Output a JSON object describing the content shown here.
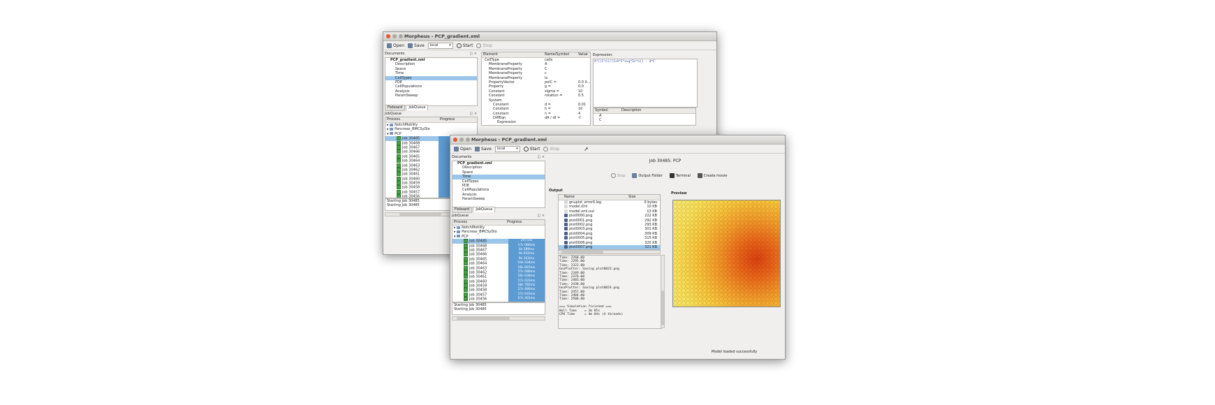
{
  "back_window": {
    "title": "Morpheus - PCP_gradient.xml",
    "toolbar": {
      "open": "Open",
      "save": "Save",
      "mode": "local",
      "start": "Start",
      "stop": "Stop"
    },
    "documents_header": "Documents",
    "doc_tree": [
      "PCP_gradient.xml",
      "Description",
      "Space",
      "Time",
      "CellTypes",
      "PDE",
      "CellPopulations",
      "Analysis",
      "ParamSweep"
    ],
    "tabs": [
      "Fixboard",
      "JobQueue"
    ],
    "jobqueue_header": "JobQueue",
    "columns": {
      "process": "Process",
      "progress": "Progress"
    },
    "groups": [
      "NotchMotility",
      "Pancreas_BMCSyDio",
      "PCP"
    ],
    "jobs": [
      "Job 30485",
      "Job 30468",
      "Job 30467",
      "Job 30466",
      "Job 30465",
      "Job 30464",
      "Job 30463",
      "Job 30462",
      "Job 30461",
      "Job 30460",
      "Job 30459",
      "Job 30458",
      "Job 30457",
      "Job 30456"
    ],
    "log": [
      "Starting Job 30485",
      "Starting Job 30485"
    ],
    "editor_columns": {
      "element": "Element",
      "name": "Name/Symbol",
      "value": "Value"
    },
    "editor_rows": [
      {
        "el": "CellType",
        "name": "cells",
        "val": ""
      },
      {
        "el": "MembraneProperty",
        "name": "A",
        "val": ""
      },
      {
        "el": "MembraneProperty",
        "name": "C",
        "val": ""
      },
      {
        "el": "MembraneProperty",
        "name": "c",
        "val": ""
      },
      {
        "el": "MembraneProperty",
        "name": "Ix",
        "val": ""
      },
      {
        "el": "PropertyVector",
        "name": "polC =",
        "val": "0.0 0..."
      },
      {
        "el": "Property",
        "name": "g =",
        "val": "0.0"
      },
      {
        "el": "Constant",
        "name": "sigma =",
        "val": "10"
      },
      {
        "el": "Constant",
        "name": "rotation =",
        "val": "0.5"
      },
      {
        "el": "System",
        "name": "",
        "val": ""
      },
      {
        "el": "Constant",
        "name": "d =",
        "val": "0.01"
      },
      {
        "el": "Constant",
        "name": "h =",
        "val": "10"
      },
      {
        "el": "Constant",
        "name": "n =",
        "val": "4"
      },
      {
        "el": "DiffEqn",
        "name": "dA / dt =",
        "val": "-f"
      },
      {
        "el": "Expression",
        "name": "",
        "val": ""
      },
      {
        "el": "DiffEqn",
        "name": "dC / dt =",
        "val": "f"
      }
    ],
    "expression_label": "Expression:",
    "expression": "A*((C^n)/(1+h*C^n+g*Ix^n)) - d*C",
    "symbol_columns": {
      "symbol": "Symbol",
      "description": "Description"
    },
    "symbols": [
      "A",
      "C"
    ]
  },
  "front_window": {
    "title": "Morpheus - PCP_gradient.xml",
    "toolbar": {
      "open": "Open",
      "save": "Save",
      "mode": "local",
      "start": "Start",
      "stop": "Stop"
    },
    "documents_header": "Documents",
    "doc_tree": [
      "PCP_gradient.xml",
      "Description",
      "Space",
      "Time",
      "CellTypes",
      "PDE",
      "CellPopulations",
      "Analysis",
      "ParamSweep"
    ],
    "tabs": [
      "Fixboard",
      "JobQueue"
    ],
    "jobqueue_header": "JobQueue",
    "columns": {
      "process": "Process",
      "progress": "Progress"
    },
    "groups": [
      "NotchMotility",
      "Pancreas_BMCSyDio",
      "PCP"
    ],
    "jobs": [
      {
        "name": "Job 30485",
        "progress": "2m 55s"
      },
      {
        "name": "Job 30468",
        "progress": "17s 080ms"
      },
      {
        "name": "Job 30467",
        "progress": "8s 589ms"
      },
      {
        "name": "Job 30466",
        "progress": "8s 032ms"
      },
      {
        "name": "Job 30465",
        "progress": "8s 343ms"
      },
      {
        "name": "Job 30464",
        "progress": "54s 634ms"
      },
      {
        "name": "Job 30463",
        "progress": "56s 822ms"
      },
      {
        "name": "Job 30462",
        "progress": "57s 086ms"
      },
      {
        "name": "Job 30461",
        "progress": "56s 038ms"
      },
      {
        "name": "Job 30460",
        "progress": "57s 020ms"
      },
      {
        "name": "Job 30459",
        "progress": "58s 782ms"
      },
      {
        "name": "Job 30458",
        "progress": "57s 486ms"
      },
      {
        "name": "Job 30457",
        "progress": "57s 033ms"
      },
      {
        "name": "Job 30456",
        "progress": "57s 301ms"
      }
    ],
    "log": [
      "Starting Job 30485",
      "Starting Job 30485"
    ],
    "job_title": "Job 30485: PCP",
    "job_buttons": {
      "stop": "Stop",
      "output": "Output Folder",
      "terminal": "Terminal",
      "movie": "Create movie"
    },
    "output_label": "Output",
    "file_columns": {
      "name": "Name",
      "size": "Size"
    },
    "files": [
      {
        "name": "gnuplot_error0.log",
        "size": "0 bytes"
      },
      {
        "name": "model.xml",
        "size": "10 KB"
      },
      {
        "name": "model.xml.out",
        "size": "13 KB"
      },
      {
        "name": "plot0000.png",
        "size": "222 KB"
      },
      {
        "name": "plot0001.png",
        "size": "292 KB"
      },
      {
        "name": "plot0002.png",
        "size": "293 KB"
      },
      {
        "name": "plot0003.png",
        "size": "301 KB"
      },
      {
        "name": "plot0004.png",
        "size": "309 KB"
      },
      {
        "name": "plot0005.png",
        "size": "315 KB"
      },
      {
        "name": "plot0006.png",
        "size": "320 KB"
      },
      {
        "name": "plot0007.png",
        "size": "321 KB"
      },
      {
        "name": "plot0008.png",
        "size": "324 KB"
      }
    ],
    "selected_file_index": 10,
    "preview_label": "Preview",
    "terminal": [
      "Time: 2268.00",
      "Time: 2295.00",
      "Time: 2322.00",
      "GnuPlotter: Saving plot0023.png",
      "Time: 2349.00",
      "Time: 2376.00",
      "Time: 2403.00",
      "Time: 2430.00",
      "GnuPlotter: Saving plot0024.png",
      "Time: 2457.00",
      "Time: 2484.00",
      "Time: 2500.00",
      "",
      "=== Simulation finished ===",
      "Wall Time    = 2m 85s",
      "CPU Time     = 4m 04s (4 threads)"
    ],
    "status": "Model loaded successfully"
  }
}
